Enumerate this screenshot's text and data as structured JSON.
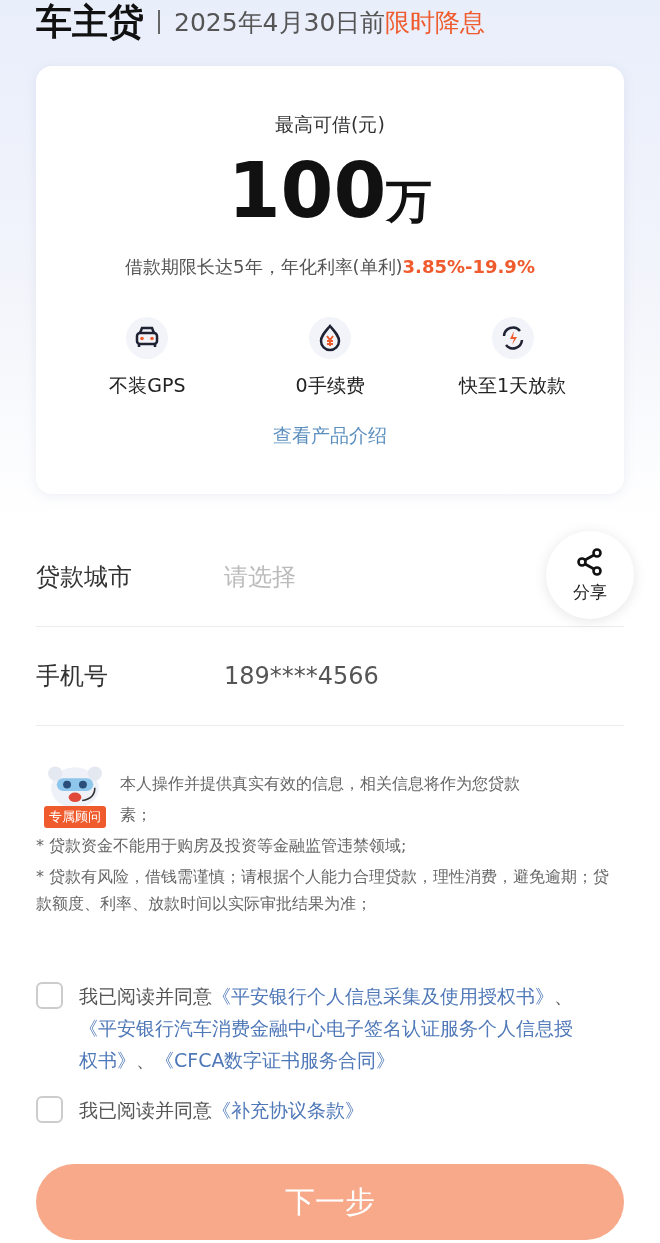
{
  "header": {
    "title": "车主贷",
    "subtitle": "2025年4月30日前",
    "highlight": "限时降息"
  },
  "card": {
    "label": "最高可借(元)",
    "amount": "100",
    "unit": "万",
    "terms": "借款期限长达5年，年化利率(单利)",
    "rate": "3.85%-19.9%",
    "features": [
      {
        "kind": "car",
        "label": "不装GPS"
      },
      {
        "kind": "fee",
        "label": "0手续费"
      },
      {
        "kind": "fast",
        "label": "快至1天放款"
      }
    ],
    "link": "查看产品介绍"
  },
  "form": [
    {
      "label": "贷款城市",
      "placeholder": "请选择"
    },
    {
      "label": "手机号",
      "value": "189****4566"
    }
  ],
  "share": {
    "label": "分享"
  },
  "notice": {
    "lines": [
      "本人操作并提供真实有效的信息，相关信息将作为您贷款",
      "素；",
      "* 贷款资金不能用于购房及投资等金融监管违禁领域;",
      "* 贷款有风险，借钱需谨慎；请根据个人能力合理贷款，理性消费，避免逾期；贷款额度、利率、放款时间以实际审批结果为准；"
    ]
  },
  "advisor": {
    "badge": "专属顾问"
  },
  "agreements": [
    {
      "checked": false,
      "prefix": "我已阅读并同意",
      "separator": "、",
      "links": [
        "《平安银行个人信息采集及使用授权书》",
        "《平安银行汽车消费金融中心电子签名认证服务个人信息授权书》",
        "《CFCA数字证书服务合同》"
      ]
    },
    {
      "checked": false,
      "prefix": "我已阅读并同意",
      "links": [
        "《补充协议条款》"
      ]
    }
  ],
  "next_button": {
    "label": "下一步",
    "disabled": true
  }
}
